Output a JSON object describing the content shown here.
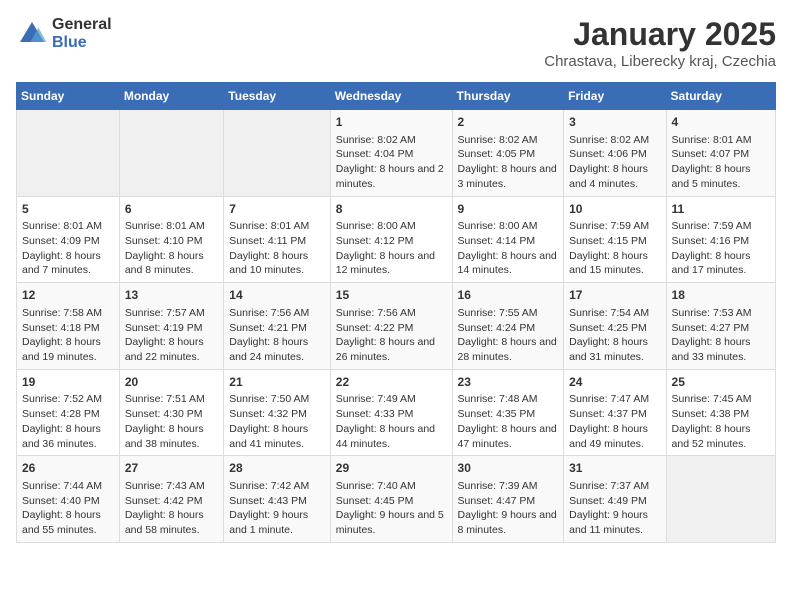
{
  "logo": {
    "general": "General",
    "blue": "Blue"
  },
  "title": "January 2025",
  "subtitle": "Chrastava, Liberecky kraj, Czechia",
  "days_of_week": [
    "Sunday",
    "Monday",
    "Tuesday",
    "Wednesday",
    "Thursday",
    "Friday",
    "Saturday"
  ],
  "weeks": [
    {
      "cells": [
        {
          "day": null,
          "content": null
        },
        {
          "day": null,
          "content": null
        },
        {
          "day": null,
          "content": null
        },
        {
          "day": "1",
          "content": "Sunrise: 8:02 AM\nSunset: 4:04 PM\nDaylight: 8 hours and 2 minutes."
        },
        {
          "day": "2",
          "content": "Sunrise: 8:02 AM\nSunset: 4:05 PM\nDaylight: 8 hours and 3 minutes."
        },
        {
          "day": "3",
          "content": "Sunrise: 8:02 AM\nSunset: 4:06 PM\nDaylight: 8 hours and 4 minutes."
        },
        {
          "day": "4",
          "content": "Sunrise: 8:01 AM\nSunset: 4:07 PM\nDaylight: 8 hours and 5 minutes."
        }
      ]
    },
    {
      "cells": [
        {
          "day": "5",
          "content": "Sunrise: 8:01 AM\nSunset: 4:09 PM\nDaylight: 8 hours and 7 minutes."
        },
        {
          "day": "6",
          "content": "Sunrise: 8:01 AM\nSunset: 4:10 PM\nDaylight: 8 hours and 8 minutes."
        },
        {
          "day": "7",
          "content": "Sunrise: 8:01 AM\nSunset: 4:11 PM\nDaylight: 8 hours and 10 minutes."
        },
        {
          "day": "8",
          "content": "Sunrise: 8:00 AM\nSunset: 4:12 PM\nDaylight: 8 hours and 12 minutes."
        },
        {
          "day": "9",
          "content": "Sunrise: 8:00 AM\nSunset: 4:14 PM\nDaylight: 8 hours and 14 minutes."
        },
        {
          "day": "10",
          "content": "Sunrise: 7:59 AM\nSunset: 4:15 PM\nDaylight: 8 hours and 15 minutes."
        },
        {
          "day": "11",
          "content": "Sunrise: 7:59 AM\nSunset: 4:16 PM\nDaylight: 8 hours and 17 minutes."
        }
      ]
    },
    {
      "cells": [
        {
          "day": "12",
          "content": "Sunrise: 7:58 AM\nSunset: 4:18 PM\nDaylight: 8 hours and 19 minutes."
        },
        {
          "day": "13",
          "content": "Sunrise: 7:57 AM\nSunset: 4:19 PM\nDaylight: 8 hours and 22 minutes."
        },
        {
          "day": "14",
          "content": "Sunrise: 7:56 AM\nSunset: 4:21 PM\nDaylight: 8 hours and 24 minutes."
        },
        {
          "day": "15",
          "content": "Sunrise: 7:56 AM\nSunset: 4:22 PM\nDaylight: 8 hours and 26 minutes."
        },
        {
          "day": "16",
          "content": "Sunrise: 7:55 AM\nSunset: 4:24 PM\nDaylight: 8 hours and 28 minutes."
        },
        {
          "day": "17",
          "content": "Sunrise: 7:54 AM\nSunset: 4:25 PM\nDaylight: 8 hours and 31 minutes."
        },
        {
          "day": "18",
          "content": "Sunrise: 7:53 AM\nSunset: 4:27 PM\nDaylight: 8 hours and 33 minutes."
        }
      ]
    },
    {
      "cells": [
        {
          "day": "19",
          "content": "Sunrise: 7:52 AM\nSunset: 4:28 PM\nDaylight: 8 hours and 36 minutes."
        },
        {
          "day": "20",
          "content": "Sunrise: 7:51 AM\nSunset: 4:30 PM\nDaylight: 8 hours and 38 minutes."
        },
        {
          "day": "21",
          "content": "Sunrise: 7:50 AM\nSunset: 4:32 PM\nDaylight: 8 hours and 41 minutes."
        },
        {
          "day": "22",
          "content": "Sunrise: 7:49 AM\nSunset: 4:33 PM\nDaylight: 8 hours and 44 minutes."
        },
        {
          "day": "23",
          "content": "Sunrise: 7:48 AM\nSunset: 4:35 PM\nDaylight: 8 hours and 47 minutes."
        },
        {
          "day": "24",
          "content": "Sunrise: 7:47 AM\nSunset: 4:37 PM\nDaylight: 8 hours and 49 minutes."
        },
        {
          "day": "25",
          "content": "Sunrise: 7:45 AM\nSunset: 4:38 PM\nDaylight: 8 hours and 52 minutes."
        }
      ]
    },
    {
      "cells": [
        {
          "day": "26",
          "content": "Sunrise: 7:44 AM\nSunset: 4:40 PM\nDaylight: 8 hours and 55 minutes."
        },
        {
          "day": "27",
          "content": "Sunrise: 7:43 AM\nSunset: 4:42 PM\nDaylight: 8 hours and 58 minutes."
        },
        {
          "day": "28",
          "content": "Sunrise: 7:42 AM\nSunset: 4:43 PM\nDaylight: 9 hours and 1 minute."
        },
        {
          "day": "29",
          "content": "Sunrise: 7:40 AM\nSunset: 4:45 PM\nDaylight: 9 hours and 5 minutes."
        },
        {
          "day": "30",
          "content": "Sunrise: 7:39 AM\nSunset: 4:47 PM\nDaylight: 9 hours and 8 minutes."
        },
        {
          "day": "31",
          "content": "Sunrise: 7:37 AM\nSunset: 4:49 PM\nDaylight: 9 hours and 11 minutes."
        },
        {
          "day": null,
          "content": null
        }
      ]
    }
  ]
}
